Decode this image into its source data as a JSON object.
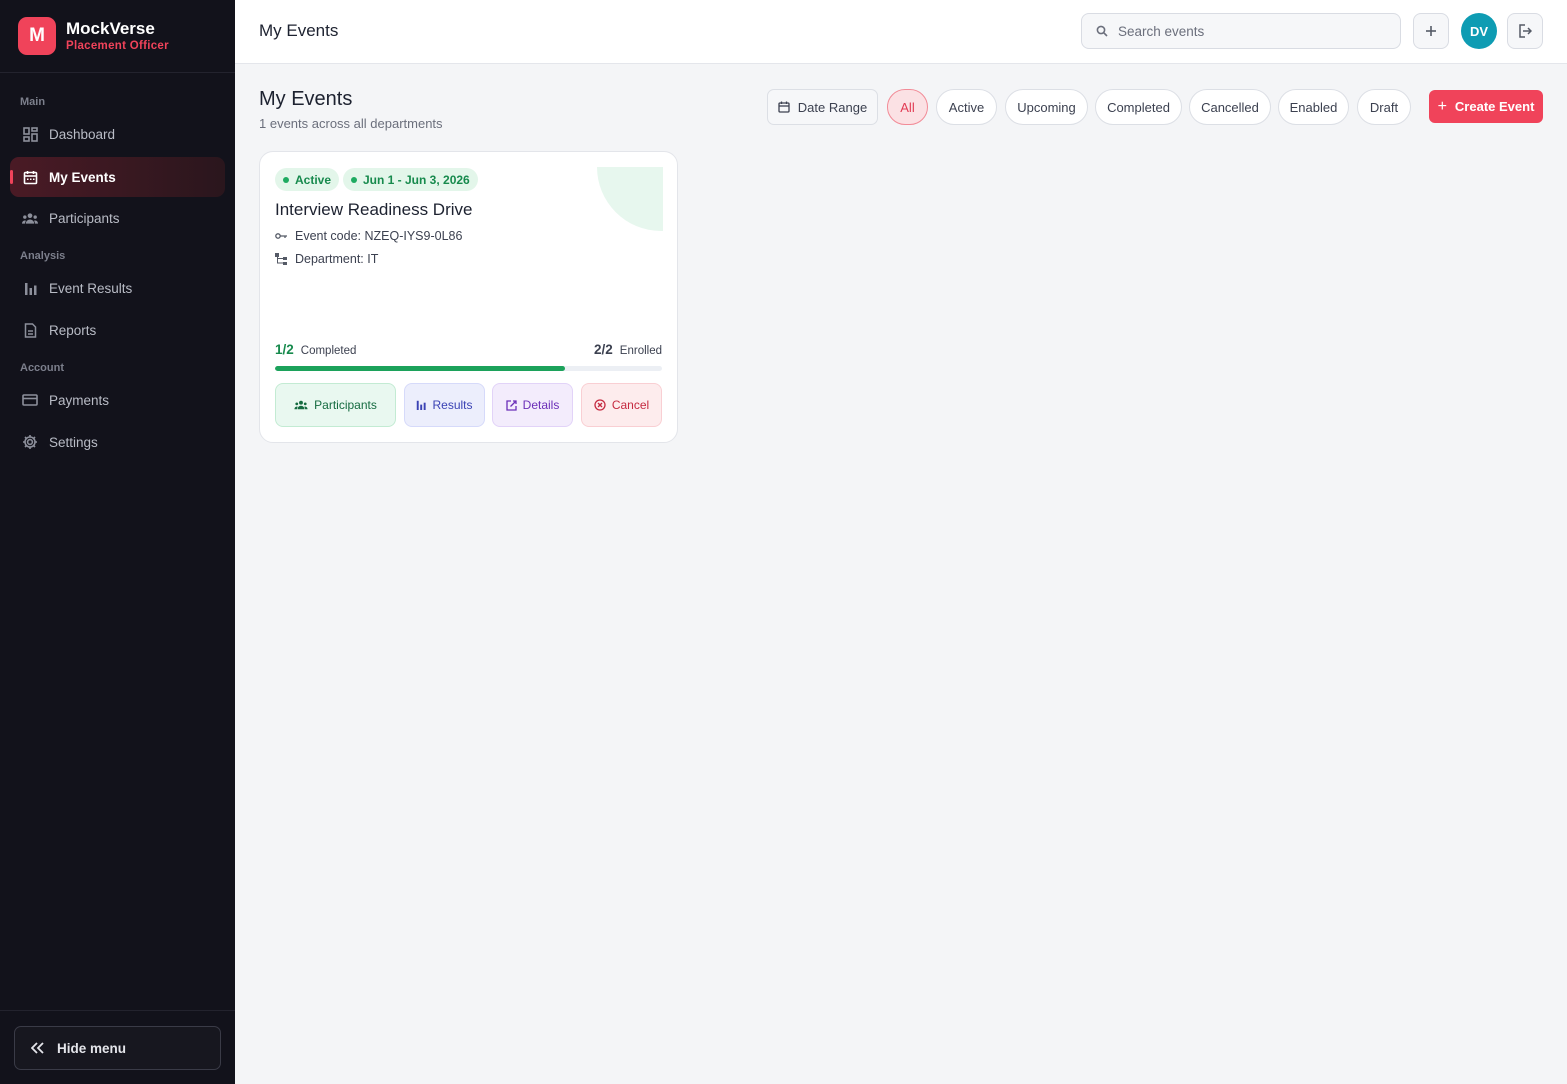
{
  "app": {
    "logo_letter": "M",
    "name": "MockVerse",
    "role": "Placement Officer"
  },
  "sidebar": {
    "sections": [
      "Main",
      "Analysis",
      "Account"
    ],
    "items": [
      {
        "label": "Dashboard",
        "icon": "dashboard-icon"
      },
      {
        "label": "My Events",
        "icon": "calendar-icon",
        "active": true
      },
      {
        "label": "Participants",
        "icon": "people-icon"
      },
      {
        "label": "Event Results",
        "icon": "bar-chart-icon"
      },
      {
        "label": "Reports",
        "icon": "document-icon"
      },
      {
        "label": "Payments",
        "icon": "card-icon"
      },
      {
        "label": "Settings",
        "icon": "gear-icon"
      }
    ],
    "hide_menu_label": "Hide menu"
  },
  "topbar": {
    "title": "My Events",
    "search_placeholder": "Search events",
    "avatar_initials": "DV"
  },
  "main": {
    "title": "My Events",
    "subtitle": "1 events across all departments",
    "date_range_label": "Date Range",
    "filters": [
      "All",
      "Active",
      "Upcoming",
      "Completed",
      "Cancelled",
      "Enabled",
      "Draft"
    ],
    "selected_filter": "All",
    "create_label": "Create Event"
  },
  "event": {
    "status": "Active",
    "date_range": "Jun 1 - Jun 3, 2026",
    "title": "Interview Readiness Drive",
    "code": "Event code: NZEQ-IYS9-0L86",
    "department": "Department: IT",
    "completed_value": "1/2",
    "completed_label": "Completed",
    "enrolled_value": "2/2",
    "enrolled_label": "Enrolled",
    "progress_fraction": 0.75,
    "actions": {
      "participants": "Participants",
      "results": "Results",
      "details": "Details",
      "cancel": "Cancel"
    }
  },
  "colors": {
    "accent": "#f0435a",
    "success": "#1ca25b",
    "sidebar_bg": "#12121b",
    "avatar": "#0e9cb3"
  }
}
